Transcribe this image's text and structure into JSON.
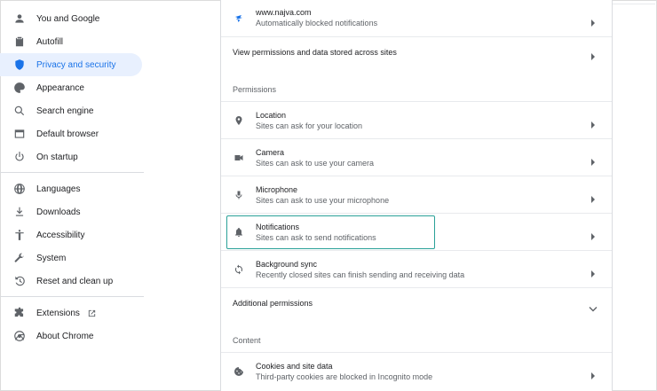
{
  "sidebar": {
    "items": [
      {
        "label": "You and Google",
        "icon": "person-icon"
      },
      {
        "label": "Autofill",
        "icon": "clipboard-icon"
      },
      {
        "label": "Privacy and security",
        "icon": "shield-icon"
      },
      {
        "label": "Appearance",
        "icon": "palette-icon"
      },
      {
        "label": "Search engine",
        "icon": "search-icon"
      },
      {
        "label": "Default browser",
        "icon": "browser-icon"
      },
      {
        "label": "On startup",
        "icon": "power-icon"
      },
      {
        "label": "Languages",
        "icon": "globe-icon"
      },
      {
        "label": "Downloads",
        "icon": "download-icon"
      },
      {
        "label": "Accessibility",
        "icon": "accessibility-icon"
      },
      {
        "label": "System",
        "icon": "wrench-icon"
      },
      {
        "label": "Reset and clean up",
        "icon": "restore-icon"
      },
      {
        "label": "Extensions",
        "icon": "puzzle-icon"
      },
      {
        "label": "About Chrome",
        "icon": "chrome-icon"
      }
    ],
    "active_index": 2
  },
  "main": {
    "site_row": {
      "title": "www.najva.com",
      "subtitle": "Automatically blocked notifications",
      "icon": "najva-site-icon"
    },
    "view_permissions": "View permissions and data stored across sites",
    "permissions_heading": "Permissions",
    "permissions": [
      {
        "title": "Location",
        "subtitle": "Sites can ask for your location",
        "icon": "location-pin-icon"
      },
      {
        "title": "Camera",
        "subtitle": "Sites can ask to use your camera",
        "icon": "camera-icon"
      },
      {
        "title": "Microphone",
        "subtitle": "Sites can ask to use your microphone",
        "icon": "microphone-icon"
      },
      {
        "title": "Notifications",
        "subtitle": "Sites can ask to send notifications",
        "icon": "bell-icon"
      },
      {
        "title": "Background sync",
        "subtitle": "Recently closed sites can finish sending and receiving data",
        "icon": "sync-icon"
      }
    ],
    "additional_permissions": "Additional permissions",
    "content_heading": "Content",
    "cookies": {
      "title": "Cookies and site data",
      "subtitle": "Third-party cookies are blocked in Incognito mode",
      "icon": "cookie-icon"
    }
  },
  "colors": {
    "accent": "#1a73e8",
    "active_bg": "#e8f0fe",
    "focus_ring": "#2aa198"
  }
}
